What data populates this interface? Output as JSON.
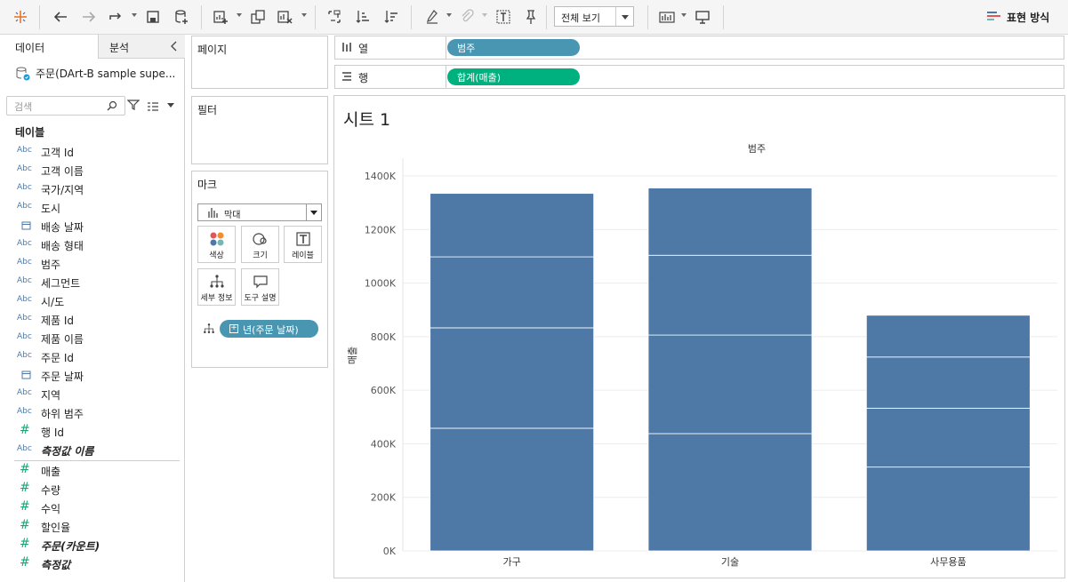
{
  "toolbar": {
    "view_select": "전체 보기",
    "show_me": "표현 방식"
  },
  "datapane": {
    "tab_data": "데이터",
    "tab_analysis": "분석",
    "datasource": "주문(DArt-B sample supe...",
    "search_placeholder": "검색",
    "tables_title": "테이블",
    "dimensions": [
      {
        "type": "Abc",
        "name": "고객 Id"
      },
      {
        "type": "Abc",
        "name": "고객 이름"
      },
      {
        "type": "Abc",
        "name": "국가/지역"
      },
      {
        "type": "Abc",
        "name": "도시"
      },
      {
        "type": "date",
        "name": "배송 날짜"
      },
      {
        "type": "Abc",
        "name": "배송 형태"
      },
      {
        "type": "Abc",
        "name": "범주"
      },
      {
        "type": "Abc",
        "name": "세그먼트"
      },
      {
        "type": "Abc",
        "name": "시/도"
      },
      {
        "type": "Abc",
        "name": "제품 Id"
      },
      {
        "type": "Abc",
        "name": "제품 이름"
      },
      {
        "type": "Abc",
        "name": "주문 Id"
      },
      {
        "type": "date",
        "name": "주문 날짜"
      },
      {
        "type": "Abc",
        "name": "지역"
      },
      {
        "type": "Abc",
        "name": "하위 범주"
      },
      {
        "type": "#",
        "name": "행 Id"
      },
      {
        "type": "Abc",
        "name": "측정값 이름",
        "italic": true
      }
    ],
    "measures": [
      {
        "type": "#",
        "name": "매출"
      },
      {
        "type": "#",
        "name": "수량"
      },
      {
        "type": "#",
        "name": "수익"
      },
      {
        "type": "#",
        "name": "할인율"
      },
      {
        "type": "#",
        "name": "주문(카운트)",
        "italic": true
      },
      {
        "type": "#",
        "name": "측정값",
        "italic": true
      }
    ]
  },
  "cards": {
    "pages": "페이지",
    "filters": "필터",
    "marks": "마크",
    "marks_type": "막대",
    "btn_color": "색상",
    "btn_size": "크기",
    "btn_label": "레이블",
    "btn_detail": "세부 정보",
    "btn_tooltip": "도구 설명",
    "detail_pill": "년(주문 날짜)"
  },
  "shelves": {
    "columns_label": "열",
    "columns_pill": "범주",
    "rows_label": "행",
    "rows_pill": "합계(매출)"
  },
  "colors": {
    "bar": "#4e79a7",
    "dim_pill": "#4996b2",
    "measure_pill": "#00b180"
  },
  "sheet": {
    "title": "시트 1"
  },
  "chart_data": {
    "type": "bar",
    "stacked": true,
    "title": "범주",
    "ylabel": "매출",
    "ylim": [
      0,
      1440000
    ],
    "yticks": [
      0,
      200000,
      400000,
      600000,
      800000,
      1000000,
      1200000,
      1400000
    ],
    "ytick_labels": [
      "0K",
      "200K",
      "400K",
      "600K",
      "800K",
      "1000K",
      "1200K",
      "1400K"
    ],
    "categories": [
      "가구",
      "기술",
      "사무용품"
    ],
    "segments": [
      [
        458000,
        375000,
        265000,
        237000
      ],
      [
        438000,
        368000,
        298000,
        251000
      ],
      [
        313000,
        220000,
        191000,
        156000
      ]
    ],
    "grid": true
  }
}
